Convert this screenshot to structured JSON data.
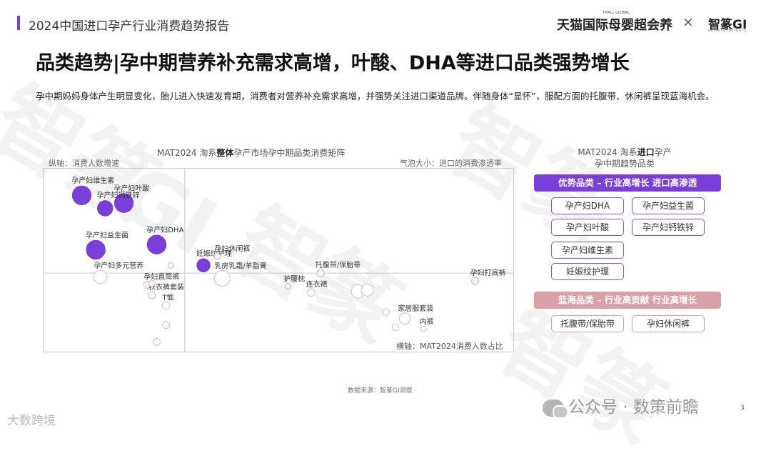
{
  "header": {
    "report_title": "2024中国进口孕产行业消费趋势报告",
    "brand_tmall": "天猫国际母婴超会养",
    "brand_tmall_sup": "TMALL GLOBAL",
    "brand_separator": "×",
    "brand_gi": "智篆GI",
    "brand_gi_sub": "GROWTH INSIGHTS"
  },
  "main_title": "品类趋势|孕中期营养补充需求高增，叶酸、DHA等进口品类强势增长",
  "intro": "孕中期妈妈身体产生明显变化，胎儿进入快速发育期，消费者对营养补充需求高增，并强势关注进口渠道品牌。伴随身体“显怀”，服配方面的托腹带、休闲裤呈现蓝海机会。",
  "chart_data": {
    "type": "scatter",
    "title_parts": [
      "MAT2024 淘系",
      "整体",
      "孕产市场孕中期品类消费矩阵"
    ],
    "ylabel": "纵轴：消费人数增速",
    "xlabel": "横轴：MAT2024消费人数占比",
    "bubble_note": "气泡大小：进口的消费渗透率",
    "colors": {
      "highlight": "#7a3fd8",
      "minor": "#e4b7bd",
      "other": "#cfcfcf"
    },
    "points": [
      {
        "name": "孕产妇维生素",
        "x": 0.08,
        "y": 0.8,
        "size": 0.7,
        "group": "highlight"
      },
      {
        "name": "孕产妇叶酸",
        "x": 0.17,
        "y": 0.74,
        "size": 0.7,
        "group": "highlight"
      },
      {
        "name": "孕产妇钙铁锌",
        "x": 0.13,
        "y": 0.7,
        "size": 0.55,
        "group": "highlight"
      },
      {
        "name": "孕产妇益生菌",
        "x": 0.11,
        "y": 0.38,
        "size": 0.7,
        "group": "highlight"
      },
      {
        "name": "孕产妇DHA",
        "x": 0.24,
        "y": 0.42,
        "size": 0.7,
        "group": "highlight"
      },
      {
        "name": "妊娠纹护理",
        "x": 0.34,
        "y": 0.26,
        "size": 0.45,
        "group": "highlight"
      },
      {
        "name": "孕妇休闲裤",
        "x": 0.37,
        "y": 0.33,
        "size": 0.08,
        "group": "minor"
      },
      {
        "name": "孕产妇多元营养",
        "x": 0.12,
        "y": 0.17,
        "size": 0.4,
        "group": "other"
      },
      {
        "name": "孕妇直筒裤",
        "x": 0.22,
        "y": 0.11,
        "size": 0.12,
        "group": "other"
      },
      {
        "name": "秋衣裤套装",
        "x": 0.23,
        "y": 0.03,
        "size": 0.12,
        "group": "other"
      },
      {
        "name": "T恤",
        "x": 0.26,
        "y": -0.05,
        "size": 0.14,
        "group": "other"
      },
      {
        "name": "乳房乳霜/羊脂膏",
        "x": 0.38,
        "y": 0.16,
        "size": 0.5,
        "group": "other"
      },
      {
        "name": "护腰枕",
        "x": 0.52,
        "y": 0.1,
        "size": 0.06,
        "group": "minor"
      },
      {
        "name": "托腹带/保胎带",
        "x": 0.59,
        "y": 0.2,
        "size": 0.14,
        "group": "minor"
      },
      {
        "name": "连衣裙",
        "x": 0.57,
        "y": 0.05,
        "size": 0.15,
        "group": "other"
      },
      {
        "name": "家居服套装",
        "x": 0.77,
        "y": -0.15,
        "size": 0.3,
        "group": "other"
      },
      {
        "name": "内裤",
        "x": 0.81,
        "y": -0.23,
        "size": 0.05,
        "group": "other"
      },
      {
        "name": "孕妇打底裤",
        "x": 0.92,
        "y": 0.14,
        "size": 0.12,
        "group": "minor"
      },
      {
        "name": "",
        "x": 0.67,
        "y": 0.06,
        "size": 0.4,
        "group": "other"
      },
      {
        "name": "",
        "x": 0.69,
        "y": 0.07,
        "size": 0.35,
        "group": "other"
      },
      {
        "name": "",
        "x": 0.73,
        "y": -0.1,
        "size": 0.1,
        "group": "other"
      },
      {
        "name": "",
        "x": 0.75,
        "y": -0.22,
        "size": 0.1,
        "group": "other"
      },
      {
        "name": "",
        "x": 0.26,
        "y": -0.2,
        "size": 0.12,
        "group": "other"
      },
      {
        "name": "",
        "x": 0.24,
        "y": -0.33,
        "size": 0.12,
        "group": "other"
      },
      {
        "name": "",
        "x": 0.27,
        "y": 0.26,
        "size": 0.05,
        "group": "minor"
      },
      {
        "name": "",
        "x": 0.23,
        "y": 0.12,
        "size": 0.08,
        "group": "other"
      }
    ],
    "xlim": [
      0,
      1
    ],
    "ylim": [
      -0.4,
      1.0
    ],
    "x_divider": 0.3,
    "y_divider": 0.2,
    "grid": false
  },
  "side_panel": {
    "title_parts": [
      "MAT2024 淘系",
      "进口",
      "孕产"
    ],
    "title_line2": "孕中期趋势品类",
    "advantage_banner": "优势品类 – 行业高增长 进口高渗透",
    "advantage_items": [
      "孕产妇DHA",
      "孕产妇益生菌",
      "孕产妇叶酸",
      "孕产妇钙铁锌",
      "孕产妇维生素",
      "妊娠纹护理"
    ],
    "blue_ocean_banner": "蓝海品类 – 行业高贡献 行业高增长",
    "blue_ocean_items": [
      "托腹带/保胎带",
      "孕妇休闲裤"
    ]
  },
  "footer": {
    "source": "数据来源：智篆GI洞察",
    "wechat": "公众号 · 数策前瞻",
    "page_num": "3",
    "corner_logo": "大数跨境"
  },
  "watermark": {
    "text_1": "智篆",
    "text_2": "GI"
  }
}
